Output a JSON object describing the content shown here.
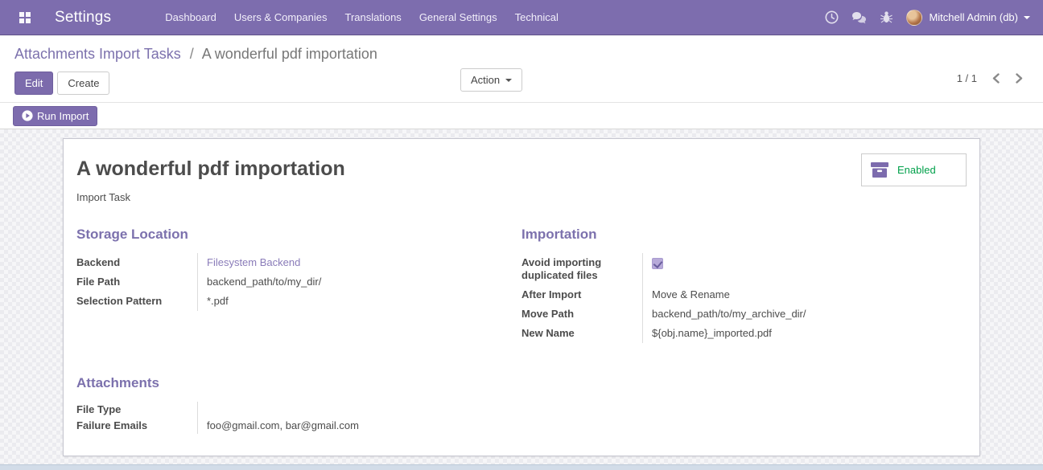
{
  "navbar": {
    "app_name": "Settings",
    "menu_items": [
      {
        "label": "Dashboard"
      },
      {
        "label": "Users & Companies"
      },
      {
        "label": "Translations"
      },
      {
        "label": "General Settings"
      },
      {
        "label": "Technical"
      }
    ],
    "user": {
      "name": "Mitchell Admin (db)"
    }
  },
  "control_panel": {
    "breadcrumb": {
      "parent": "Attachments Import Tasks",
      "separator": "/",
      "current": "A wonderful pdf importation"
    },
    "buttons": {
      "edit": "Edit",
      "create": "Create",
      "action": "Action"
    },
    "pager": {
      "value": "1 / 1"
    }
  },
  "statusbar": {
    "run_import_label": "Run Import"
  },
  "sheet": {
    "title": "A wonderful pdf importation",
    "subtitle": "Import Task",
    "enabled_button": {
      "label": "Enabled"
    },
    "groups": [
      {
        "title": "Storage Location",
        "fields": [
          {
            "label": "Backend",
            "value": "Filesystem Backend",
            "type": "link"
          },
          {
            "label": "File Path",
            "value": "backend_path/to/my_dir/",
            "type": "text"
          },
          {
            "label": "Selection Pattern",
            "value": "*.pdf",
            "type": "text"
          }
        ]
      },
      {
        "title": "Importation",
        "fields": [
          {
            "label": "Avoid importing duplicated files",
            "type": "checkbox",
            "checked": true
          },
          {
            "label": "After Import",
            "value": "Move & Rename",
            "type": "text"
          },
          {
            "label": "Move Path",
            "value": "backend_path/to/my_archive_dir/",
            "type": "text"
          },
          {
            "label": "New Name",
            "value": "${obj.name}_imported.pdf",
            "type": "text"
          }
        ]
      },
      {
        "title": "Attachments",
        "fields": [
          {
            "label": "File Type",
            "value": "",
            "type": "text"
          },
          {
            "label": "Failure Emails",
            "value": "foo@gmail.com, bar@gmail.com",
            "type": "text"
          }
        ]
      }
    ]
  },
  "icons": {
    "apps_menu": "apps-grid-icon",
    "clock": "clock-icon",
    "messages": "messages-icon",
    "bug": "bug-icon",
    "run_import": "play-circle-icon",
    "enabled": "archive-box-icon",
    "pager_prev": "chevron-left-icon",
    "pager_next": "chevron-right-icon"
  },
  "colors": {
    "navbar": "#7d6dae",
    "primary_button": "#7c6bac",
    "link_purple": "#7c71ad",
    "success_green": "#00a04a",
    "text": "#4c4c4c"
  }
}
